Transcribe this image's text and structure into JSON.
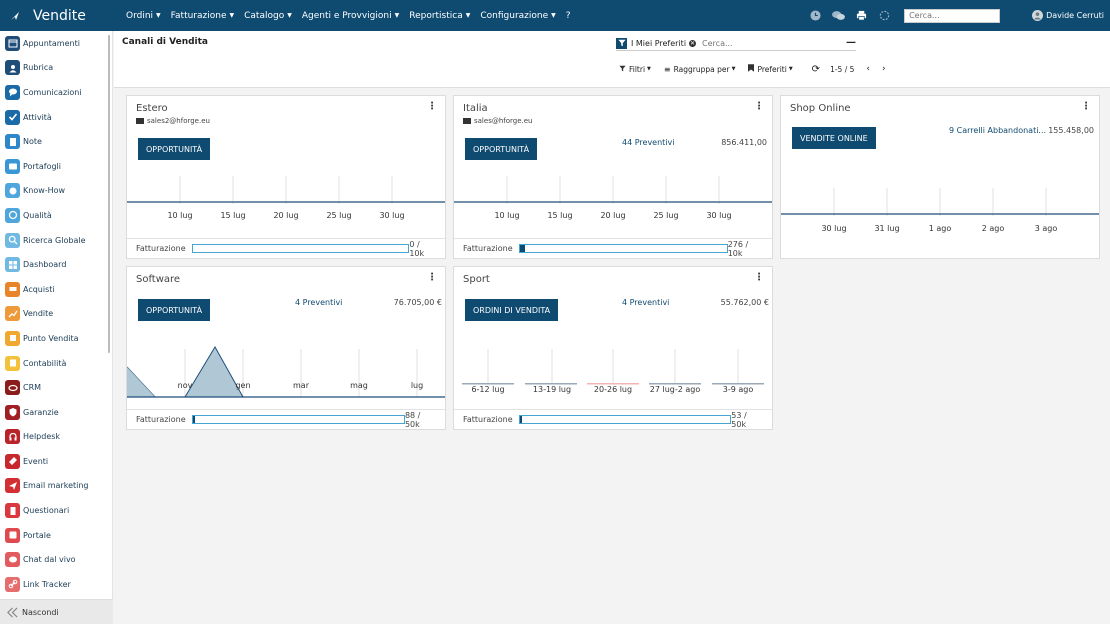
{
  "app": {
    "title": "Vendite"
  },
  "topbar": {
    "menus": [
      {
        "label": "Ordini"
      },
      {
        "label": "Fatturazione"
      },
      {
        "label": "Catalogo"
      },
      {
        "label": "Agenti e Provvigioni"
      },
      {
        "label": "Reportistica"
      },
      {
        "label": "Configurazione"
      }
    ],
    "help": "?",
    "search_placeholder": "Cerca...",
    "user": "Davide Cerruti"
  },
  "sidebar": {
    "items": [
      {
        "label": "Appuntamenti",
        "color": "#1f4e79",
        "icon": "calendar-icon"
      },
      {
        "label": "Rubrica",
        "color": "#1f4e79",
        "icon": "address-book-icon"
      },
      {
        "label": "Comunicazioni",
        "color": "#1a6aa8",
        "icon": "chat-icon"
      },
      {
        "label": "Attività",
        "color": "#1a6aa8",
        "icon": "check-icon"
      },
      {
        "label": "Note",
        "color": "#2f86c9",
        "icon": "note-icon"
      },
      {
        "label": "Portafogli",
        "color": "#3a97d6",
        "icon": "wallet-icon"
      },
      {
        "label": "Know-How",
        "color": "#4ea6dc",
        "icon": "brain-icon"
      },
      {
        "label": "Qualità",
        "color": "#4ea6dc",
        "icon": "quality-icon"
      },
      {
        "label": "Ricerca Globale",
        "color": "#6fb9e3",
        "icon": "search-icon"
      },
      {
        "label": "Dashboard",
        "color": "#6fb9e3",
        "icon": "dashboard-icon"
      },
      {
        "label": "Acquisti",
        "color": "#e8852a",
        "icon": "cart-icon"
      },
      {
        "label": "Vendite",
        "color": "#ef9a3a",
        "icon": "chart-icon"
      },
      {
        "label": "Punto Vendita",
        "color": "#f0a830",
        "icon": "pos-icon"
      },
      {
        "label": "Contabilità",
        "color": "#f3c13a",
        "icon": "accounting-icon"
      },
      {
        "label": "CRM",
        "color": "#8b1c1c",
        "icon": "crm-icon"
      },
      {
        "label": "Garanzie",
        "color": "#a01f24",
        "icon": "shield-icon"
      },
      {
        "label": "Helpdesk",
        "color": "#b8242a",
        "icon": "headset-icon"
      },
      {
        "label": "Eventi",
        "color": "#c8282d",
        "icon": "ticket-icon"
      },
      {
        "label": "Email marketing",
        "color": "#d22e33",
        "icon": "paper-plane-icon"
      },
      {
        "label": "Questionari",
        "color": "#d9393e",
        "icon": "survey-icon"
      },
      {
        "label": "Portale",
        "color": "#df4a4e",
        "icon": "portal-icon"
      },
      {
        "label": "Chat dal vivo",
        "color": "#e25c5f",
        "icon": "live-chat-icon"
      },
      {
        "label": "Link Tracker",
        "color": "#e66c6e",
        "icon": "link-icon"
      }
    ],
    "hide_label": "Nascondi"
  },
  "control_panel": {
    "breadcrumb": "Canali di Vendita",
    "facet": "I Miei Preferiti",
    "search_placeholder": "Cerca...",
    "filters": "Filtri",
    "group_by": "Raggruppa per",
    "favorites": "Preferiti",
    "pager": "1-5 / 5"
  },
  "cards": {
    "estero": {
      "title": "Estero",
      "email": "sales2@hforge.eu",
      "button": "OPPORTUNITÀ",
      "ticks": [
        "10 lug",
        "15 lug",
        "20 lug",
        "25 lug",
        "30 lug"
      ],
      "footer_label": "Fatturazione",
      "progress_text": "0 / 10k",
      "progress": 0
    },
    "italia": {
      "title": "Italia",
      "email": "sales@hforge.eu",
      "button": "OPPORTUNITÀ",
      "link": "44 Preventivi",
      "amount": "856.411,00",
      "ticks": [
        "10 lug",
        "15 lug",
        "20 lug",
        "25 lug",
        "30 lug"
      ],
      "footer_label": "Fatturazione",
      "progress_text": "276 / 10k",
      "progress": 0.0276
    },
    "shop": {
      "title": "Shop Online",
      "button": "VENDITE ONLINE",
      "link": "9 Carrelli Abbandonati...",
      "amount": "155.458,00",
      "ticks": [
        "30 lug",
        "31 lug",
        "1 ago",
        "2 ago",
        "3 ago"
      ]
    },
    "software": {
      "title": "Software",
      "button": "OPPORTUNITÀ",
      "link": "4 Preventivi",
      "amount": "76.705,00 €",
      "ticks": [
        "nov",
        "gen",
        "mar",
        "mag",
        "lug"
      ],
      "footer_label": "Fatturazione",
      "progress_text": "88 / 50k",
      "progress": 0.00176
    },
    "sport": {
      "title": "Sport",
      "button": "ORDINI DI VENDITA",
      "link": "4 Preventivi",
      "amount": "55.762,00 €",
      "ticks": [
        "6-12 lug",
        "13-19 lug",
        "20-26 lug",
        "27 lug-2 ago",
        "3-9 ago"
      ],
      "footer_label": "Fatturazione",
      "progress_text": "53 / 50k",
      "progress": 0.00106
    }
  }
}
